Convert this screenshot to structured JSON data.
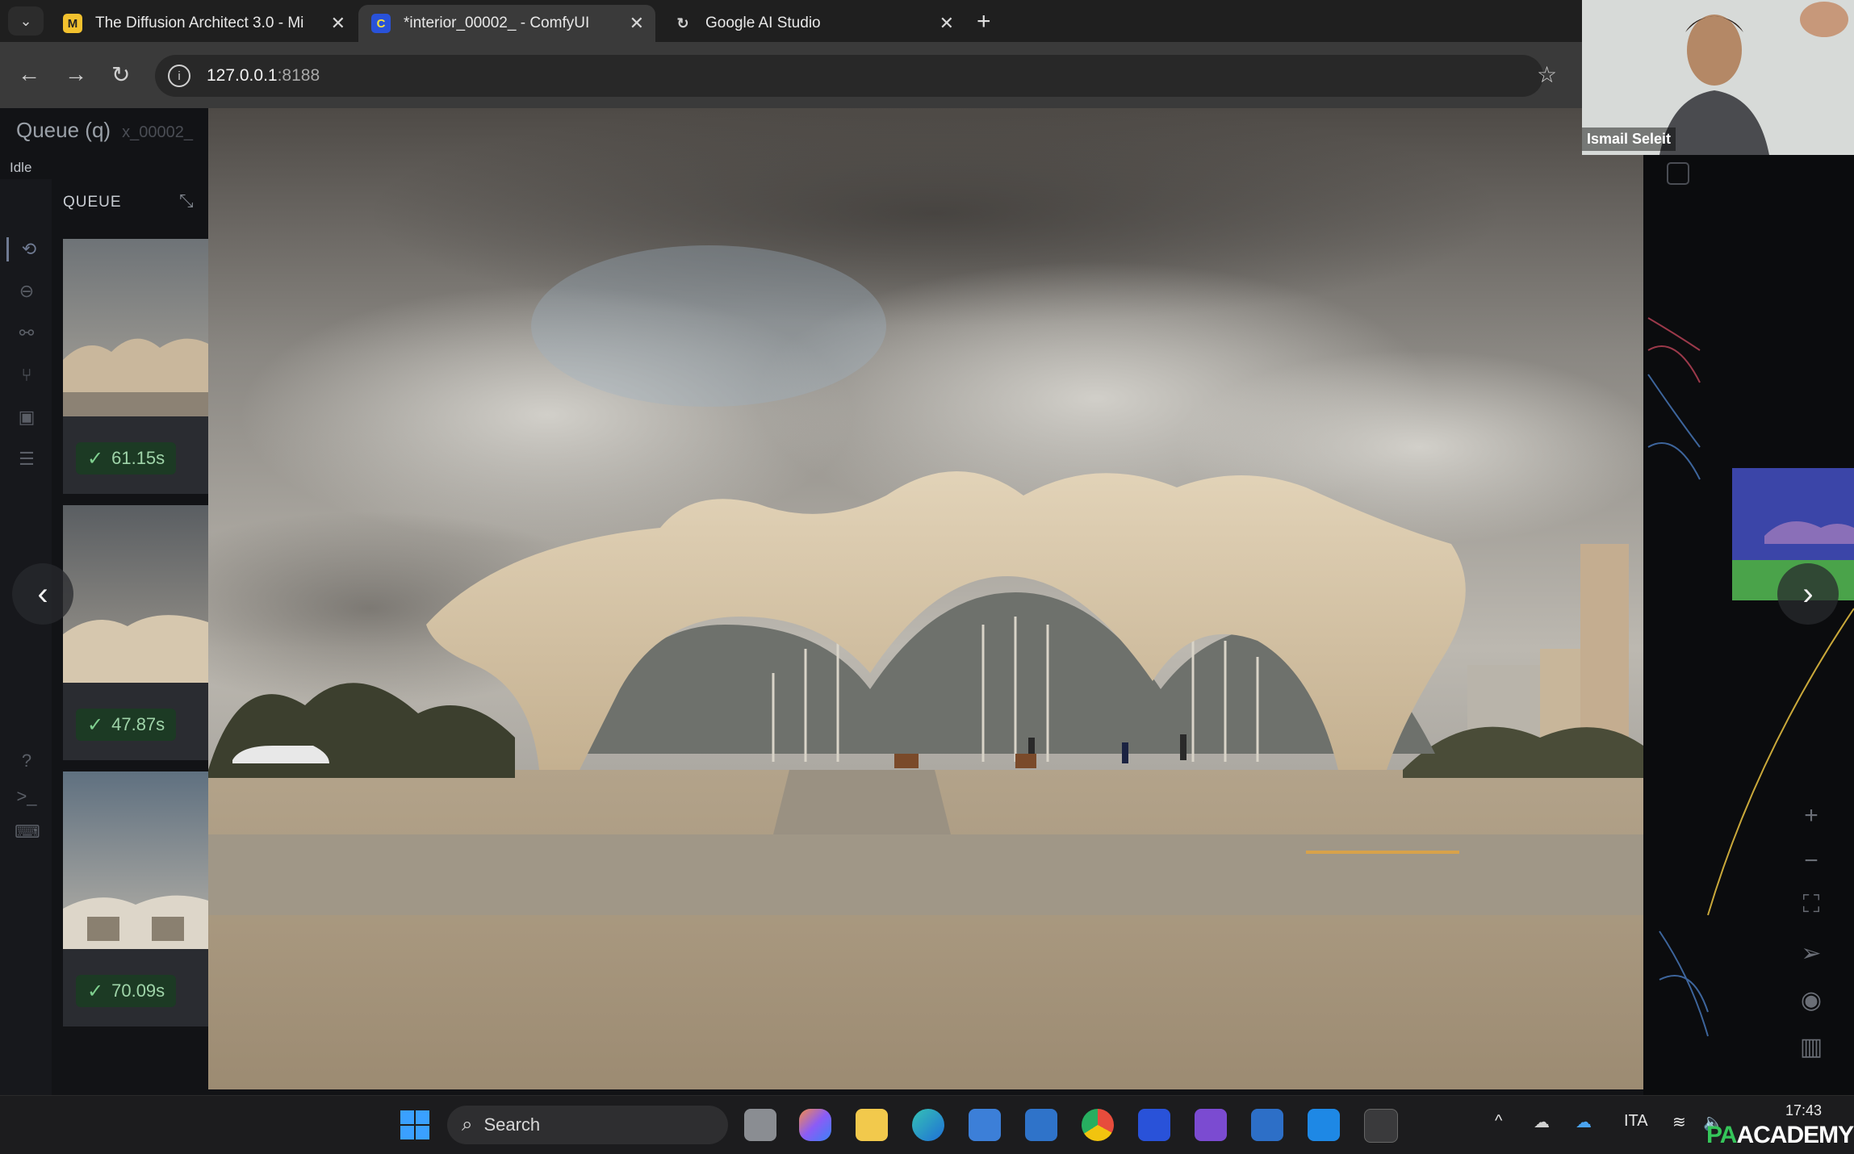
{
  "browser": {
    "tabs": [
      {
        "title": "The Diffusion Architect 3.0 - Mi",
        "favicon": "notebook-icon",
        "active": false
      },
      {
        "title": "*interior_00002_ - ComfyUI",
        "favicon": "comfyui-icon",
        "active": true
      },
      {
        "title": "Google AI Studio",
        "favicon": "google-ai-icon",
        "active": false
      }
    ],
    "url_host": "127.0.0.1",
    "url_port": ":8188"
  },
  "app": {
    "queue_header": "Queue (q)",
    "queue_sub": "x_00002_",
    "status": "Idle",
    "queue_title": "QUEUE",
    "queue_items": [
      {
        "duration": "61.15s"
      },
      {
        "duration": "47.87s"
      },
      {
        "duration": "70.09s"
      }
    ]
  },
  "webcam": {
    "name": "Ismail Seleit"
  },
  "taskbar": {
    "search_label": "Search",
    "language": "ITA",
    "time": "17:43",
    "logo_pa": "PA",
    "logo_academy": "ACADEMY"
  },
  "colors": {
    "accent_green": "#35c65a",
    "badge_bg": "#1c3a24"
  }
}
